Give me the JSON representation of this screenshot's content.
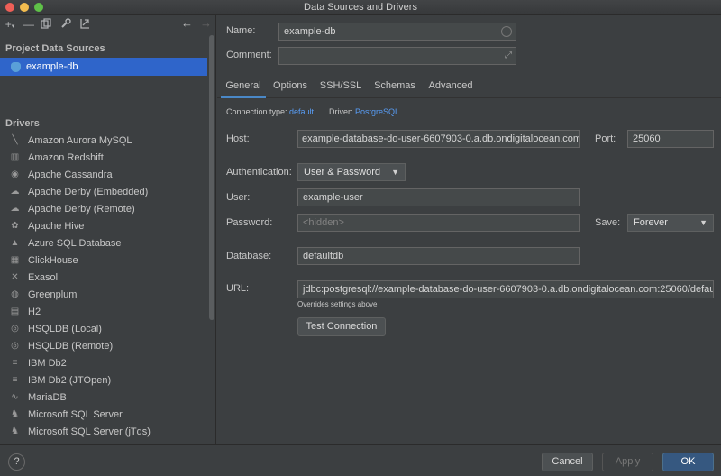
{
  "window": {
    "title": "Data Sources and Drivers"
  },
  "sidebar": {
    "project_title": "Project Data Sources",
    "selected_source": "example-db",
    "drivers_title": "Drivers",
    "drivers": [
      {
        "label": "Amazon Aurora MySQL",
        "icon": "aurora-icon"
      },
      {
        "label": "Amazon Redshift",
        "icon": "redshift-icon"
      },
      {
        "label": "Apache Cassandra",
        "icon": "cassandra-icon"
      },
      {
        "label": "Apache Derby (Embedded)",
        "icon": "derby-icon"
      },
      {
        "label": "Apache Derby (Remote)",
        "icon": "derby-icon"
      },
      {
        "label": "Apache Hive",
        "icon": "hive-icon"
      },
      {
        "label": "Azure SQL Database",
        "icon": "azure-icon"
      },
      {
        "label": "ClickHouse",
        "icon": "clickhouse-icon"
      },
      {
        "label": "Exasol",
        "icon": "exasol-icon"
      },
      {
        "label": "Greenplum",
        "icon": "greenplum-icon"
      },
      {
        "label": "H2",
        "icon": "h2-icon"
      },
      {
        "label": "HSQLDB (Local)",
        "icon": "hsqldb-icon"
      },
      {
        "label": "HSQLDB (Remote)",
        "icon": "hsqldb-icon"
      },
      {
        "label": "IBM Db2",
        "icon": "ibm-icon"
      },
      {
        "label": "IBM Db2 (JTOpen)",
        "icon": "ibm-icon"
      },
      {
        "label": "MariaDB",
        "icon": "mariadb-icon"
      },
      {
        "label": "Microsoft SQL Server",
        "icon": "mssql-icon"
      },
      {
        "label": "Microsoft SQL Server (jTds)",
        "icon": "mssql-icon"
      }
    ]
  },
  "form": {
    "name_label": "Name:",
    "name_value": "example-db",
    "comment_label": "Comment:",
    "comment_value": "",
    "tabs": [
      "General",
      "Options",
      "SSH/SSL",
      "Schemas",
      "Advanced"
    ],
    "active_tab": "General",
    "connection_type_label": "Connection type:",
    "connection_type_value": "default",
    "driver_label": "Driver:",
    "driver_value": "PostgreSQL",
    "host_label": "Host:",
    "host_value": "example-database-do-user-6607903-0.a.db.ondigitalocean.com",
    "port_label": "Port:",
    "port_value": "25060",
    "auth_label": "Authentication:",
    "auth_value": "User & Password",
    "user_label": "User:",
    "user_value": "example-user",
    "password_label": "Password:",
    "password_placeholder": "<hidden>",
    "save_label": "Save:",
    "save_value": "Forever",
    "database_label": "Database:",
    "database_value": "defaultdb",
    "url_label": "URL:",
    "url_value": "jdbc:postgresql://example-database-do-user-6607903-0.a.db.ondigitalocean.com:25060/defau",
    "url_note": "Overrides settings above",
    "test_button": "Test Connection"
  },
  "footer": {
    "help": "?",
    "cancel": "Cancel",
    "apply": "Apply",
    "ok": "OK"
  }
}
